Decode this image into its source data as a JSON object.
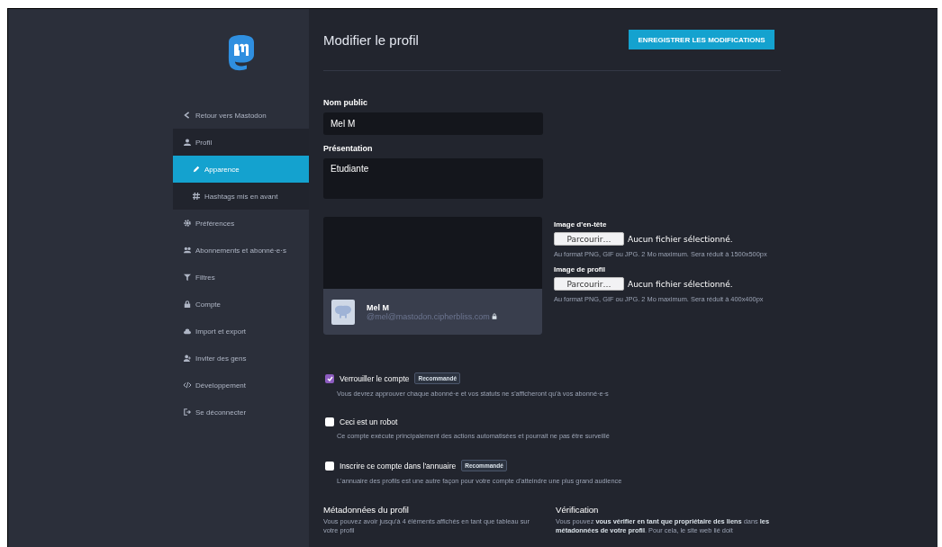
{
  "sidebar": {
    "items": [
      {
        "label": "Retour vers Mastodon",
        "selected": false
      },
      {
        "label": "Profil",
        "selected": false,
        "children": [
          {
            "label": "Apparence",
            "selected": true
          },
          {
            "label": "Hashtags mis en avant",
            "selected": false
          }
        ]
      },
      {
        "label": "Préférences",
        "selected": false
      },
      {
        "label": "Abonnements et abonné·e·s",
        "selected": false
      },
      {
        "label": "Filtres",
        "selected": false
      },
      {
        "label": "Compte",
        "selected": false
      },
      {
        "label": "Import et export",
        "selected": false
      },
      {
        "label": "Inviter des gens",
        "selected": false
      },
      {
        "label": "Développement",
        "selected": false
      },
      {
        "label": "Se déconnecter",
        "selected": false
      }
    ]
  },
  "header": {
    "title": "Modifier le profil",
    "save_button": "ENREGISTRER LES MODIFICATIONS"
  },
  "fields": [
    {
      "kind": "input",
      "label": "Nom public",
      "value": "Mel M"
    },
    {
      "kind": "textarea",
      "label": "Présentation",
      "value": "Etudiante"
    }
  ],
  "preview": {
    "name": "Mel M",
    "handle": "@mel@mastodon.cipherbliss.com",
    "locked": true
  },
  "uploads": [
    {
      "label": "Image d'en-tête",
      "button": "Parcourir…",
      "status": "Aucun fichier sélectionné.",
      "hint": "Au format PNG, GIF ou JPG. 2 Mo maximum. Sera réduit à 1500x500px"
    },
    {
      "label": "Image de profil",
      "button": "Parcourir…",
      "status": "Aucun fichier sélectionné.",
      "hint": "Au format PNG, GIF ou JPG. 2 Mo maximum. Sera réduit à 400x400px"
    }
  ],
  "checkboxes": [
    {
      "label": "Verrouiller le compte",
      "badge": "Recommandé",
      "checked": true,
      "hint": "Vous devrez approuver chaque abonné·e et vos statuts ne s'afficheront qu'à vos abonné·e·s"
    },
    {
      "label": "Ceci est un robot",
      "checked": false,
      "hint": "Ce compte exécute principalement des actions automatisées et pourrait ne pas être surveillé"
    },
    {
      "label": "Inscrire ce compte dans l'annuaire",
      "badge": "Recommandé",
      "checked": false,
      "hint": "L'annuaire des profils est une autre façon pour votre compte d'atteindre une plus grand audience"
    }
  ],
  "sections": [
    {
      "title": "Métadonnées du profil",
      "text": "Vous pouvez avoir jusqu'à 4 éléments affichés en tant que tableau sur votre profil"
    },
    {
      "title": "Vérification",
      "text": "Vous pouvez **vous vérifier en tant que propriétaire des liens** dans **les métadonnées de votre profil**. Pour cela, le site web lié doit"
    }
  ]
}
